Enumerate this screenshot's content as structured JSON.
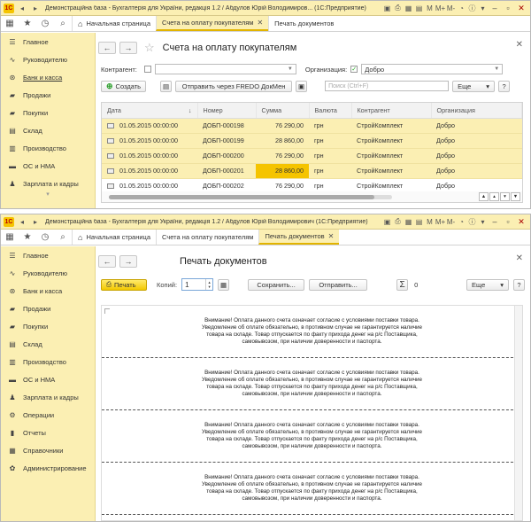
{
  "window1": {
    "titlebar": {
      "title": "Демонстраційна база - Бухгалтерія для України, редакція 1.2 / Абдулов Юрій Володимиров... (1С:Предприятие)",
      "buttons": [
        "M",
        "M+",
        "M-"
      ]
    },
    "tabs": [
      {
        "label": "Начальная страница"
      },
      {
        "label": "Счета на оплату покупателям",
        "active": true
      },
      {
        "label": "Печать документов"
      }
    ],
    "sidebar": [
      {
        "icon": "list-icon",
        "glyph": "☰",
        "label": "Главное"
      },
      {
        "icon": "chart-icon",
        "glyph": "∿",
        "label": "Руководителю"
      },
      {
        "icon": "coin-icon",
        "glyph": "⊛",
        "label": "Банк и касса",
        "underline": true
      },
      {
        "icon": "cart-icon",
        "glyph": "▰",
        "label": "Продажи"
      },
      {
        "icon": "basket-icon",
        "glyph": "▰",
        "label": "Покупки"
      },
      {
        "icon": "warehouse-icon",
        "glyph": "▤",
        "label": "Склад"
      },
      {
        "icon": "factory-icon",
        "glyph": "▥",
        "label": "Производство"
      },
      {
        "icon": "truck-icon",
        "glyph": "▬",
        "label": "ОС и НМА"
      },
      {
        "icon": "people-icon",
        "glyph": "♟",
        "label": "Зарплата и кадры"
      }
    ],
    "form": {
      "title": "Счета на оплату покупателям",
      "filter": {
        "counterparty_label": "Контрагент:",
        "organization_label": "Организация:",
        "organization_value": "Добро"
      },
      "commands": {
        "create": "Создать",
        "send_fredo": "Отправить через FREDO ДокМен",
        "search_placeholder": "Поиск (Ctrl+F)",
        "more": "Еще",
        "help": "?"
      },
      "columns": [
        "Дата",
        "Номер",
        "Сумма",
        "Валюта",
        "Контрагент",
        "Организация"
      ],
      "rows": [
        {
          "date": "01.05.2015 00:00:00",
          "number": "ДОБП-000198",
          "sum": "76 290,00",
          "currency": "грн",
          "counterparty": "СтройКомплект",
          "org": "Добро",
          "hl": true
        },
        {
          "date": "01.05.2015 00:00:00",
          "number": "ДОБП-000199",
          "sum": "28 860,00",
          "currency": "грн",
          "counterparty": "СтройКомплект",
          "org": "Добро",
          "hl": true
        },
        {
          "date": "01.05.2015 00:00:00",
          "number": "ДОБП-000200",
          "sum": "76 290,00",
          "currency": "грн",
          "counterparty": "СтройКомплект",
          "org": "Добро",
          "hl": true
        },
        {
          "date": "01.05.2015 00:00:00",
          "number": "ДОБП-000201",
          "sum": "28 860,00",
          "currency": "грн",
          "counterparty": "СтройКомплект",
          "org": "Добро",
          "hl": true,
          "sel": true
        },
        {
          "date": "01.05.2015 00:00:00",
          "number": "ДОБП-000202",
          "sum": "76 290,00",
          "currency": "грн",
          "counterparty": "СтройКомплект",
          "org": "Добро",
          "hl": false
        }
      ]
    }
  },
  "window2": {
    "titlebar": {
      "title": "Демонстраційна база - Бухгалтерія для України, редакція 1.2 / Абдулов Юрій Володимирович (1С:Предприятие)",
      "buttons": [
        "M",
        "M+",
        "M-"
      ]
    },
    "tabs": [
      {
        "label": "Начальная страница"
      },
      {
        "label": "Счета на оплату покупателям"
      },
      {
        "label": "Печать документов",
        "active": true
      }
    ],
    "sidebar": [
      {
        "icon": "list-icon",
        "glyph": "☰",
        "label": "Главное"
      },
      {
        "icon": "chart-icon",
        "glyph": "∿",
        "label": "Руководителю"
      },
      {
        "icon": "coin-icon",
        "glyph": "⊛",
        "label": "Банк и касса"
      },
      {
        "icon": "cart-icon",
        "glyph": "▰",
        "label": "Продажи"
      },
      {
        "icon": "basket-icon",
        "glyph": "▰",
        "label": "Покупки"
      },
      {
        "icon": "warehouse-icon",
        "glyph": "▤",
        "label": "Склад"
      },
      {
        "icon": "factory-icon",
        "glyph": "▥",
        "label": "Производство"
      },
      {
        "icon": "truck-icon",
        "glyph": "▬",
        "label": "ОС и НМА"
      },
      {
        "icon": "people-icon",
        "glyph": "♟",
        "label": "Зарплата и кадры"
      },
      {
        "icon": "gears-icon",
        "glyph": "⚙",
        "label": "Операции"
      },
      {
        "icon": "report-icon",
        "glyph": "▮",
        "label": "Отчеты"
      },
      {
        "icon": "book-icon",
        "glyph": "▦",
        "label": "Справочники"
      },
      {
        "icon": "settings-icon",
        "glyph": "✿",
        "label": "Администрирование"
      }
    ],
    "form": {
      "title": "Печать документов",
      "commands": {
        "print": "Печать",
        "copies_label": "Копий:",
        "copies_value": "1",
        "save": "Сохранить...",
        "send": "Отправить...",
        "sum_value": "0",
        "more": "Еще",
        "help": "?"
      },
      "notice": "Внимание! Оплата данного счета означает согласие с условиями поставки товара. Уведомление об оплате обязательно, в противном случае не гарантируется наличие товара на складе. Товар отпускается по факту прихода денег на р/с Поставщика, самовывозом, при наличии доверенности и паспорта.",
      "pages": 4
    }
  }
}
